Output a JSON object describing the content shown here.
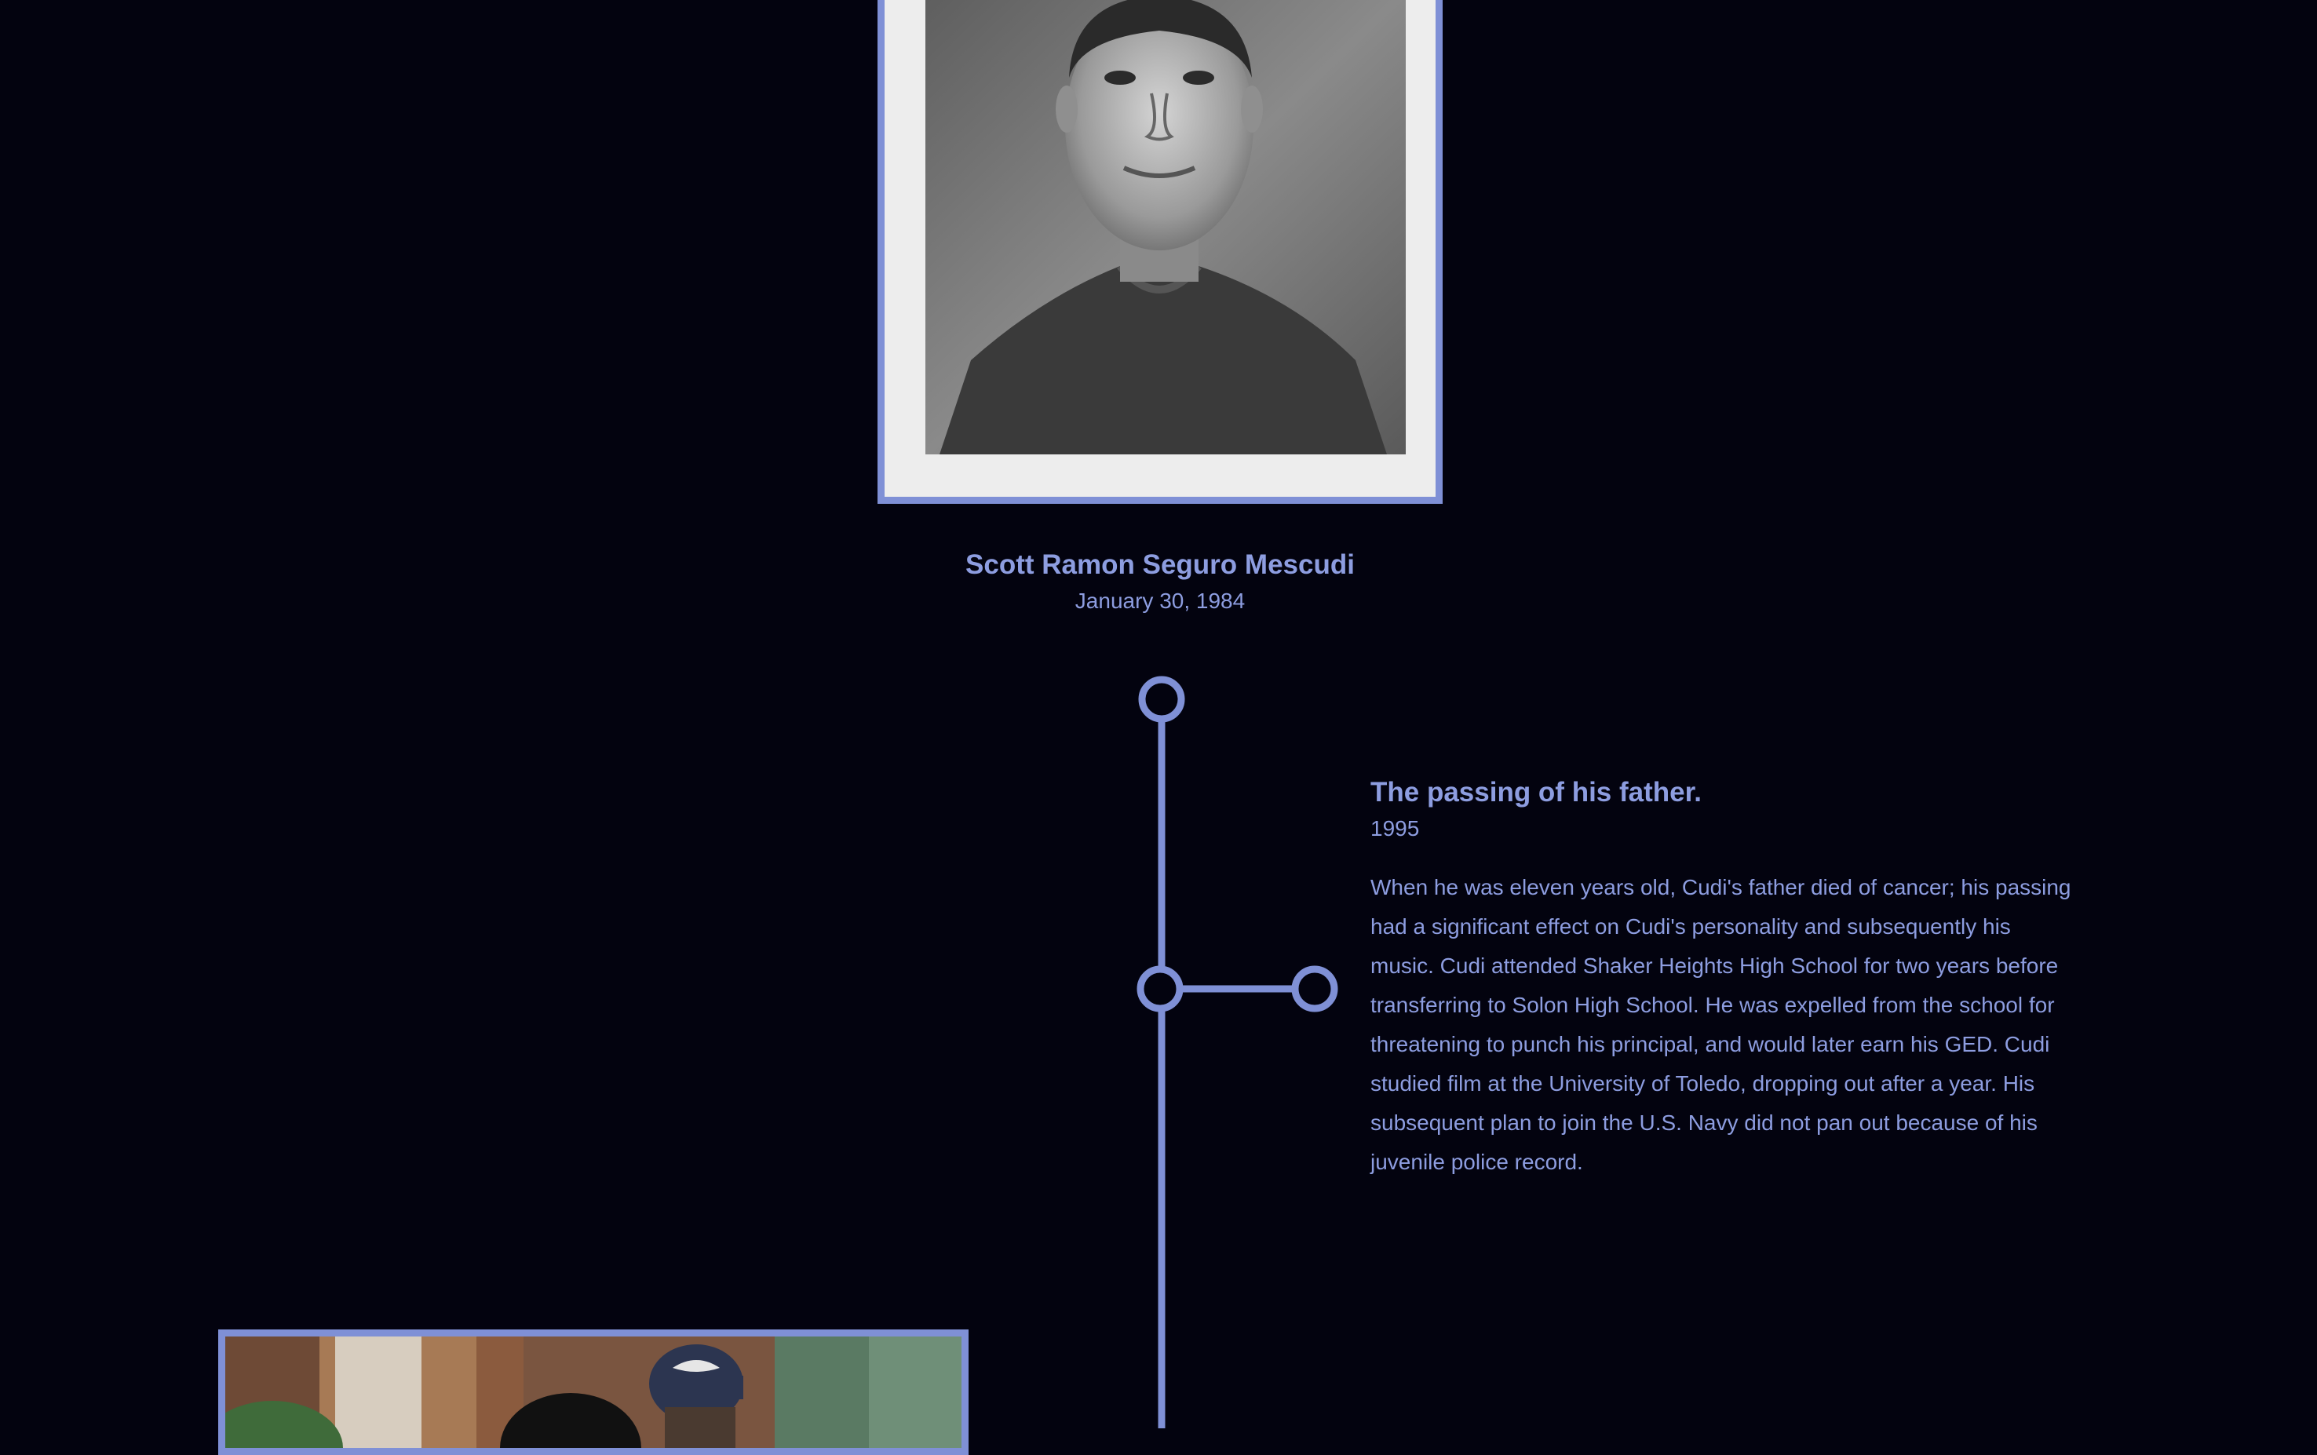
{
  "header": {
    "name": "Scott Ramon Seguro Mescudi",
    "birth_date": "January 30, 1984"
  },
  "events": [
    {
      "title": "The passing of his father.",
      "year": "1995",
      "description": "When he was eleven years old, Cudi's father died of cancer; his passing had a significant effect on Cudi's personality and subsequently his music. Cudi attended Shaker Heights High School for two years before transferring to Solon High School. He was expelled from the school for threatening to punch his principal, and would later earn his GED. Cudi studied film at the University of Toledo, dropping out after a year. His subsequent plan to join the U.S. Navy did not pan out because of his juvenile police record."
    }
  ],
  "colors": {
    "background": "#03030f",
    "accent": "#7f90d6",
    "text": "#8d9de0"
  }
}
